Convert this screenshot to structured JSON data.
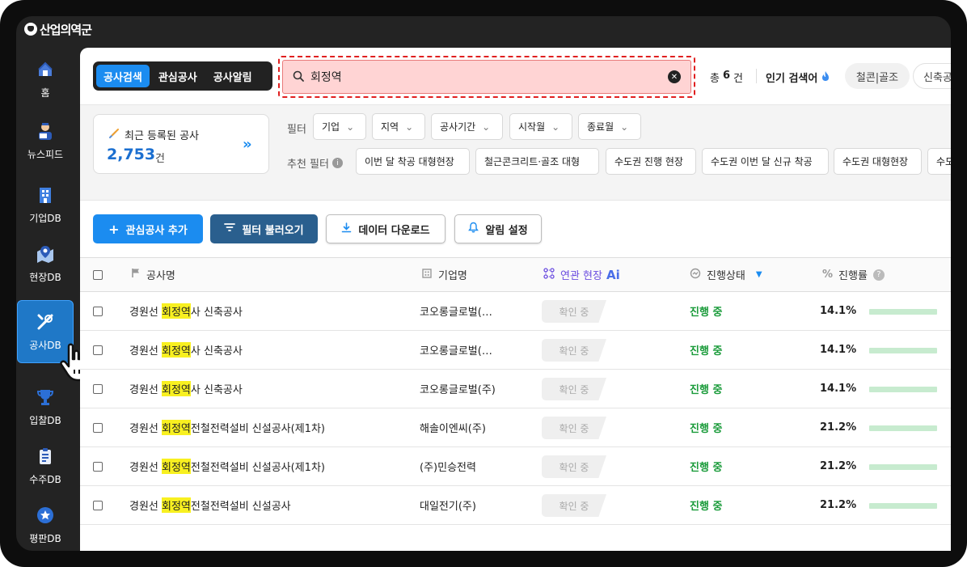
{
  "brand": "산업의역군",
  "sidebar": {
    "items": [
      {
        "label": "홈",
        "icon": "home-icon"
      },
      {
        "label": "뉴스피드",
        "icon": "newsfeed-icon"
      },
      {
        "label": "기업DB",
        "icon": "building-icon"
      },
      {
        "label": "현장DB",
        "icon": "map-pin-icon"
      },
      {
        "label": "공사DB",
        "icon": "tools-icon",
        "active": true
      },
      {
        "label": "입찰DB",
        "icon": "trophy-icon"
      },
      {
        "label": "수주DB",
        "icon": "clipboard-icon"
      },
      {
        "label": "평판DB",
        "icon": "star-badge-icon"
      }
    ]
  },
  "header": {
    "tabs": [
      "공사검색",
      "관심공사",
      "공사알림"
    ],
    "search": {
      "value": "회정역"
    },
    "total": {
      "prefix": "총",
      "count": "6",
      "unit": "건"
    },
    "popular_label": "인기 검색어",
    "popular_chips": [
      "철콘|골조",
      "신축공"
    ]
  },
  "recent": {
    "title": "최근 등록된 공사",
    "count": "2,753",
    "unit": "건"
  },
  "filters": {
    "label": "필터",
    "dropdowns": [
      "기업",
      "지역",
      "공사기간",
      "시작월",
      "종료월"
    ],
    "recommended_label": "추천 필터",
    "recommended": [
      "이번 달 착공 대형현장",
      "철근콘크리트·골조 대형",
      "수도권 진행 현장",
      "수도권 이번 달 신규 착공",
      "수도권 대형현장",
      "수도"
    ]
  },
  "actions": {
    "add_interest": "관심공사 추가",
    "load_filter": "필터 불러오기",
    "download": "데이터 다운로드",
    "alert_settings": "알림 설정"
  },
  "table": {
    "columns": {
      "name": "공사명",
      "company": "기업명",
      "related": "연관 현장",
      "related_badge": "Ai",
      "status": "진행상태",
      "progress": "진행률"
    },
    "highlight": "회정역",
    "rows": [
      {
        "prefix": "경원선 ",
        "rest": "사 신축공사",
        "company": "코오롱글로벌(…",
        "related": "확인 중",
        "status": "진행 중",
        "progress_text": "14.1%",
        "progress": 0.141
      },
      {
        "prefix": "경원선 ",
        "rest": "사 신축공사",
        "company": "코오롱글로벌(…",
        "related": "확인 중",
        "status": "진행 중",
        "progress_text": "14.1%",
        "progress": 0.141
      },
      {
        "prefix": "경원선 ",
        "rest": "사 신축공사",
        "company": "코오롱글로벌(주)",
        "related": "확인 중",
        "status": "진행 중",
        "progress_text": "14.1%",
        "progress": 0.141
      },
      {
        "prefix": "경원선 ",
        "rest": "전철전력설비 신설공사(제1차)",
        "company": "해솔이엔씨(주)",
        "related": "확인 중",
        "status": "진행 중",
        "progress_text": "21.2%",
        "progress": 0.212
      },
      {
        "prefix": "경원선 ",
        "rest": "전철전력설비 신설공사(제1차)",
        "company": "(주)민승전력",
        "related": "확인 중",
        "status": "진행 중",
        "progress_text": "21.2%",
        "progress": 0.212
      },
      {
        "prefix": "경원선 ",
        "rest": "전철전력설비 신설공사",
        "company": "대일전기(주)",
        "related": "확인 중",
        "status": "진행 중",
        "progress_text": "21.2%",
        "progress": 0.212
      }
    ]
  },
  "colors": {
    "accent": "#1b8cf0",
    "navy": "#2a5f8e",
    "status_green": "#1a9b3a",
    "highlight": "#f8f020",
    "search_bg": "#ffd4d4"
  }
}
